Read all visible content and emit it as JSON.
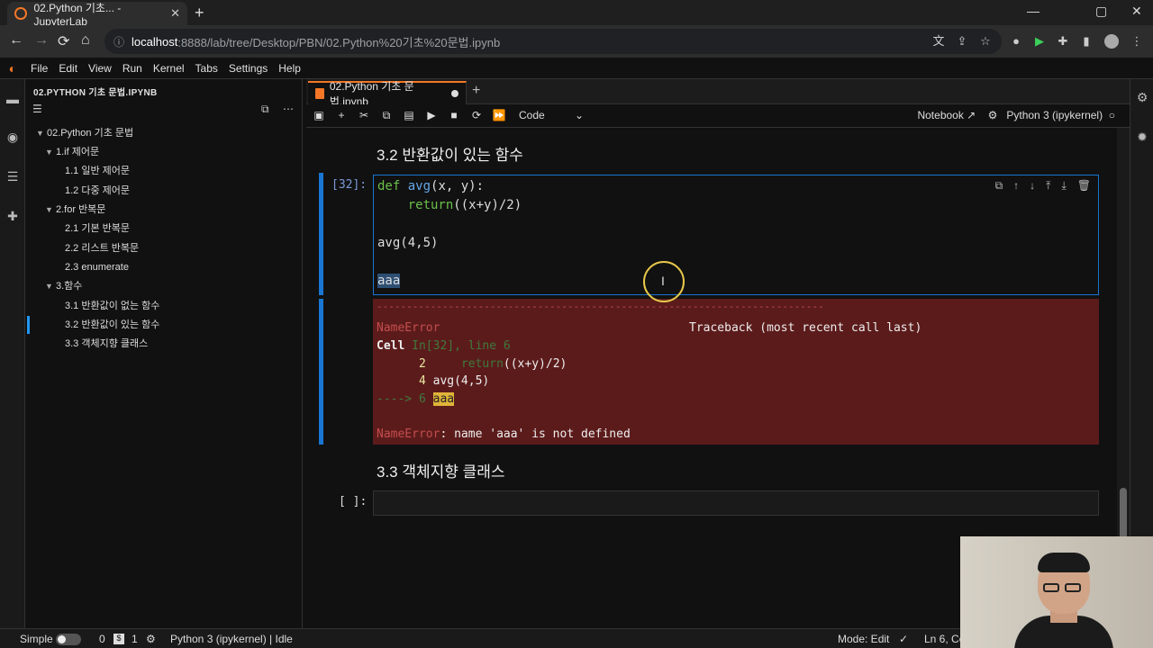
{
  "browser": {
    "tab_title": "02.Python 기초... - JupyterLab",
    "tab_close": "✕",
    "new_tab": "+",
    "win_min": "—",
    "win_max": "▢",
    "win_close": "✕",
    "back": "←",
    "forward": "→",
    "reload": "⟳",
    "home": "⌂",
    "url_host": "localhost",
    "url_path": ":8888/lab/tree/Desktop/PBN/02.Python%20기초%20문법.ipynb"
  },
  "menu": {
    "items": [
      "File",
      "Edit",
      "View",
      "Run",
      "Kernel",
      "Tabs",
      "Settings",
      "Help"
    ]
  },
  "toc": {
    "title": "02.PYTHON 기초 문법.IPYNB",
    "items": [
      {
        "label": "02.Python 기초 문법",
        "level": 1,
        "caret": "▼"
      },
      {
        "label": "1.if 제어문",
        "level": 2,
        "caret": "▼"
      },
      {
        "label": "1.1 일반 제어문",
        "level": 3,
        "caret": ""
      },
      {
        "label": "1.2 다중 제어문",
        "level": 3,
        "caret": ""
      },
      {
        "label": "2.for 반복문",
        "level": 2,
        "caret": "▼"
      },
      {
        "label": "2.1 기본 반복문",
        "level": 3,
        "caret": ""
      },
      {
        "label": "2.2 리스트 반복문",
        "level": 3,
        "caret": ""
      },
      {
        "label": "2.3 enumerate",
        "level": 3,
        "caret": ""
      },
      {
        "label": "3.함수",
        "level": 2,
        "caret": "▼"
      },
      {
        "label": "3.1 반환값이 없는 함수",
        "level": 3,
        "caret": ""
      },
      {
        "label": "3.2 반환값이 있는 함수",
        "level": 3,
        "caret": "",
        "selected": true
      },
      {
        "label": "3.3 객체지향 클래스",
        "level": 3,
        "caret": ""
      }
    ]
  },
  "notebook": {
    "tab_label": "02.Python 기초 문법.ipynb",
    "cell_type": "Code",
    "notebook_link": "Notebook ↗",
    "kernel": "Python 3 (ipykernel)",
    "heading_32": "3.2 반환값이 있는 함수",
    "prompt_32": "[32]:",
    "code_def": "def",
    "code_fname": "avg",
    "code_params": "(x, y):",
    "code_return_kw": "return",
    "code_return_expr": "((x+y)/2)",
    "code_call": "avg(4,5)",
    "code_aaa": "aaa",
    "err_dashes": "---------------------------------------------------------------------------",
    "err_name": "NameError",
    "err_traceback": "Traceback (most recent call last)",
    "err_cell": "Cell ",
    "err_cell_loc": "In[32], line 6",
    "err_line2_no": "      2",
    "err_line2_kw": "return",
    "err_line2_code": "((x+y)/2)",
    "err_line4_no": "      4",
    "err_line4_code": "avg(4,5)",
    "err_arrow": "----> 6",
    "err_line6_code": "aaa",
    "err_final_name": "NameError",
    "err_final_msg": ": name 'aaa' is not defined",
    "heading_33": "3.3 객체지향 클래스",
    "prompt_empty": "[ ]:"
  },
  "status": {
    "mode_label": "Simple",
    "count_0": "0",
    "count_1": "1",
    "kernel_status": "Python 3 (ipykernel) | Idle",
    "edit_mode": "Mode: Edit",
    "position": "Ln 6, Co"
  },
  "colors": {
    "accent": "#1976d2",
    "error_bg": "#5c1b1b",
    "jupyter_orange": "#f37726"
  }
}
